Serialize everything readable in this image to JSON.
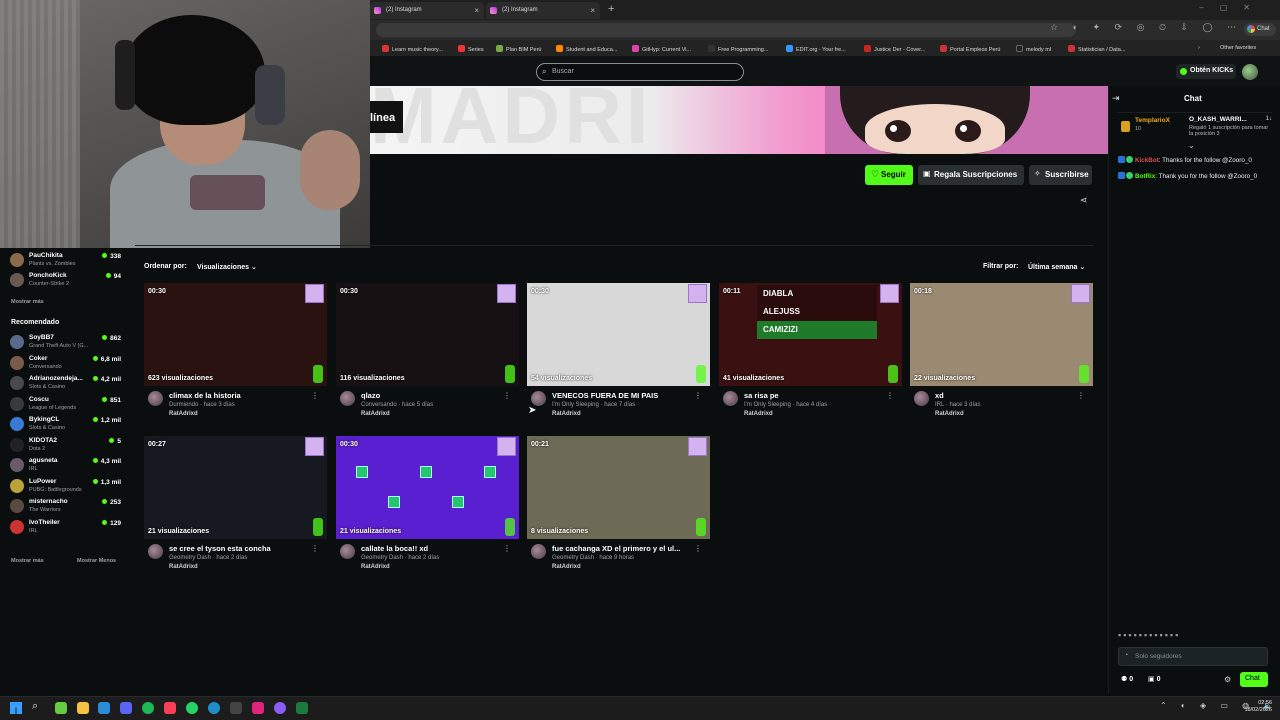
{
  "browser": {
    "tabs": [
      {
        "label": "(2) Instagram"
      },
      {
        "label": "(2) Instagram"
      }
    ],
    "new_tab": "+",
    "bookmarks": [
      {
        "label": "Learn music theory...",
        "color": "#d33"
      },
      {
        "label": "Series",
        "color": "#e33"
      },
      {
        "label": "Plan BIM Perú",
        "color": "#7a4"
      },
      {
        "label": "Student and Educa...",
        "color": "#f80"
      },
      {
        "label": "GitHyp: Current Vi...",
        "color": "#d4a"
      },
      {
        "label": "Free Programming...",
        "color": "#333"
      },
      {
        "label": "EDIT.org - Your fre...",
        "color": "#39f"
      },
      {
        "label": "Justice Der - Cover...",
        "color": "#c22"
      },
      {
        "label": "Portal Empleos Perú",
        "color": "#c33"
      },
      {
        "label": "melody ml",
        "color": "#222"
      },
      {
        "label": "Statistician / Data...",
        "color": "#c33"
      }
    ],
    "other_favorites": "Other favorites",
    "profile_label": "Chat"
  },
  "header": {
    "search_placeholder": "Buscar",
    "obten_kicks": "Obtén KICKs"
  },
  "banner": {
    "text": "MADRI",
    "status": "línea"
  },
  "actions": {
    "seguir": "Seguir",
    "regala": "Regala Suscripciones",
    "suscribirse": "Suscribirse"
  },
  "sidebar": {
    "following": [
      {
        "name": "PauChikita",
        "game": "Plants vs. Zombies",
        "viewers": "338",
        "color": "#8a6a4a"
      },
      {
        "name": "PonchoKick",
        "game": "Counter-Strike 2",
        "viewers": "94",
        "color": "#6b5a52"
      }
    ],
    "show_more_1": "Mostrar más",
    "recommended_title": "Recomendado",
    "recommended": [
      {
        "name": "SoyBB7",
        "game": "Grand Theft Auto V (G...",
        "viewers": "862",
        "color": "#5a6a8a"
      },
      {
        "name": "Coker",
        "game": "Conversando",
        "viewers": "6,8 mil",
        "color": "#7a5a48"
      },
      {
        "name": "Adrianozendeja...",
        "game": "Slots & Casino",
        "viewers": "4,2 mil",
        "color": "#4a4a4a"
      },
      {
        "name": "Coscu",
        "game": "League of Legends",
        "viewers": "851",
        "color": "#3a3a3a"
      },
      {
        "name": "BykingCL",
        "game": "Slots & Casino",
        "viewers": "1,2 mil",
        "color": "#3a7ad0"
      },
      {
        "name": "KIDOTA2",
        "game": "Dota 2",
        "viewers": "5",
        "color": "#222"
      },
      {
        "name": "agusneta",
        "game": "IRL",
        "viewers": "4,3 mil",
        "color": "#6a5a6a"
      },
      {
        "name": "LuPower",
        "game": "PUBG: Battlegrounds",
        "viewers": "1,3 mil",
        "color": "#bba23a"
      },
      {
        "name": "misternacho",
        "game": "The Warriors",
        "viewers": "253",
        "color": "#5a4a44"
      },
      {
        "name": "IvoTheiler",
        "game": "IRL",
        "viewers": "129",
        "color": "#c33"
      }
    ],
    "show_more_2": "Mostrar más",
    "show_less": "Mostrar Menos"
  },
  "filters": {
    "sort_label": "Ordenar por:",
    "sort_value": "Visualizaciones ⌄",
    "filter_label": "Filtrar por:",
    "filter_value": "Última semana ⌄"
  },
  "clips": [
    {
      "duration": "00:30",
      "views": "623 visualizaciones",
      "title": "climax de la historia",
      "category": "Durmiendo",
      "age": "hace 3 días",
      "channel": "RatAdrixd",
      "bg": "#2a1210"
    },
    {
      "duration": "00:30",
      "views": "116 visualizaciones",
      "title": "qlazo",
      "category": "Conversando",
      "age": "hace 5 días",
      "channel": "RatAdrixd",
      "bg": "#171114"
    },
    {
      "duration": "00:30",
      "views": "54 visualizaciones",
      "title": "VENECOS FUERA DE MI PAIS",
      "category": "I'm Only Sleeping",
      "age": "hace 7 días",
      "channel": "RatAdrixd",
      "bg": "#d8d8d8"
    },
    {
      "duration": "00:11",
      "views": "41 visualizaciones",
      "title": "sa risa pe",
      "category": "I'm Only Sleeping",
      "age": "hace 4 días",
      "channel": "RatAdrixd",
      "bg": "#3a1010"
    },
    {
      "duration": "00:18",
      "views": "22 visualizaciones",
      "title": "xd",
      "category": "IRL",
      "age": "hace 3 días",
      "channel": "RatAdrixd",
      "bg": "#9b8a72"
    },
    {
      "duration": "00:27",
      "views": "21 visualizaciones",
      "title": "se cree el tyson esta concha",
      "category": "Geometry Dash",
      "age": "hace 2 días",
      "channel": "RatAdrixd",
      "bg": "#161a20"
    },
    {
      "duration": "00:30",
      "views": "21 visualizaciones",
      "title": "callate la boca!! xd",
      "category": "Geometry Dash",
      "age": "hace 2 días",
      "channel": "RatAdrixd",
      "bg": "#5a1fd0"
    },
    {
      "duration": "00:21",
      "views": "8 visualizaciones",
      "title": "fue cachanga XD el primero y el ul...",
      "category": "Geometry Dash",
      "age": "hace 9 horas",
      "channel": "RatAdrixd",
      "bg": "#6d6a55"
    }
  ],
  "diabla_overlay": {
    "line1": "DIABLA",
    "line2": "ALEJUSS",
    "line3": "CAMIZIZI"
  },
  "chat": {
    "title": "Chat",
    "pinned": {
      "user1": "TemplarioX",
      "user1_count": "10",
      "user2": "O_KASH_WARRI...",
      "user2_message": "Regaló 1 suscripción para tomar la posición 3",
      "count": "1↓"
    },
    "messages": [
      {
        "user": "KickBot",
        "user_color": "#e04f4f",
        "text": ": Thanks for the follow @Zooro_0"
      },
      {
        "user": "BotRix",
        "user_color": "#53fc18",
        "text": ": Thank you for the follow @Zooro_0"
      }
    ],
    "input_placeholder": "Solo seguidores",
    "foot_count_1": "0",
    "foot_count_2": "0",
    "send_label": "Chat"
  },
  "taskbar": {
    "time": "02:56",
    "date": "18/02/2026"
  }
}
